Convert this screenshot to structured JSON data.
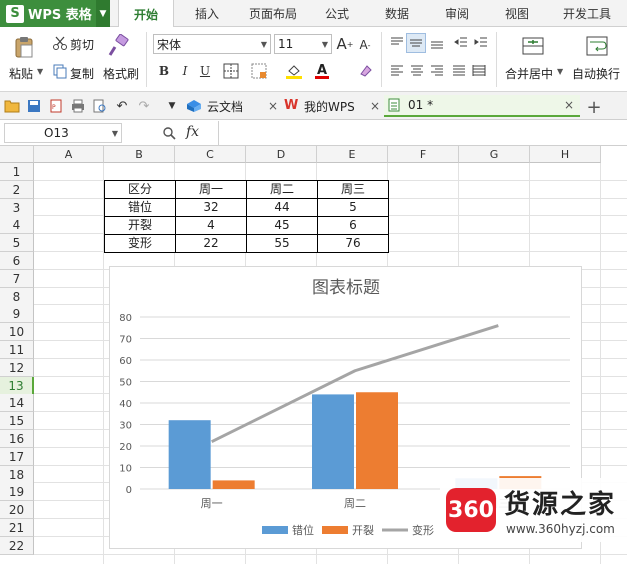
{
  "app": {
    "brand": "WPS 表格"
  },
  "tabs": [
    "开始",
    "插入",
    "页面布局",
    "公式",
    "数据",
    "审阅",
    "视图",
    "开发工具"
  ],
  "ribbon": {
    "cut": "剪切",
    "copy": "复制",
    "paste": "粘贴",
    "format_painter": "格式刷",
    "font_name": "宋体",
    "font_size": "11",
    "bold": "B",
    "italic": "I",
    "underline": "U",
    "merge_center": "合并居中",
    "auto_wrap": "自动换行"
  },
  "doc_tabs": [
    {
      "label": "云文档",
      "close": "×"
    },
    {
      "label": "我的WPS",
      "close": "×"
    },
    {
      "label": "01 *",
      "close": "×"
    }
  ],
  "formula_bar": {
    "name_box": "O13",
    "fx": "fx",
    "value": ""
  },
  "columns": [
    "A",
    "B",
    "C",
    "D",
    "E",
    "F",
    "G",
    "H"
  ],
  "rows": [
    "1",
    "2",
    "3",
    "4",
    "5",
    "6",
    "7",
    "8",
    "9",
    "10",
    "11",
    "12",
    "13",
    "14",
    "15",
    "16",
    "17",
    "18",
    "19",
    "20",
    "21",
    "22"
  ],
  "selected_row": "13",
  "table": {
    "header": [
      "区分",
      "周一",
      "周二",
      "周三"
    ],
    "rows": [
      [
        "错位",
        "32",
        "44",
        "5"
      ],
      [
        "开裂",
        "4",
        "45",
        "6"
      ],
      [
        "变形",
        "22",
        "55",
        "76"
      ]
    ]
  },
  "chart_data": {
    "type": "bar",
    "title": "图表标题",
    "categories": [
      "周一",
      "周二",
      "周三"
    ],
    "series": [
      {
        "name": "错位",
        "type": "bar",
        "values": [
          32,
          44,
          5
        ],
        "color": "#5b9bd5"
      },
      {
        "name": "开裂",
        "type": "bar",
        "values": [
          4,
          45,
          6
        ],
        "color": "#ed7d31"
      },
      {
        "name": "变形",
        "type": "line",
        "values": [
          22,
          55,
          76
        ],
        "color": "#a5a5a5"
      }
    ],
    "ylim": [
      0,
      80
    ],
    "yticks": [
      "0",
      "10",
      "20",
      "30",
      "40",
      "50",
      "60",
      "70",
      "80"
    ],
    "grid": true,
    "legend": "bottom"
  },
  "watermark": {
    "logo": "360",
    "text": "货源之家",
    "url": "www.360hyzj.com"
  }
}
